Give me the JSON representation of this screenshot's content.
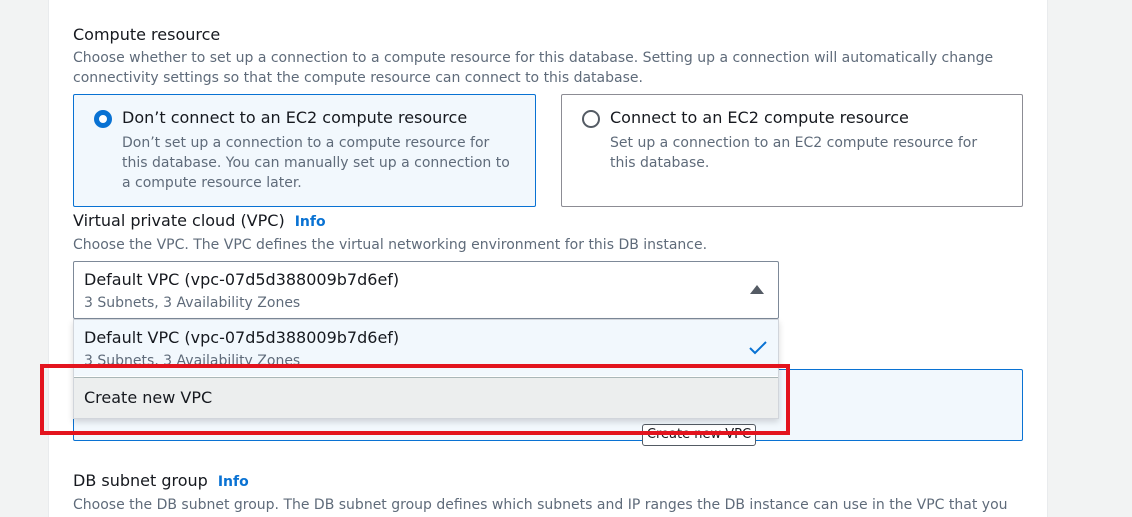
{
  "compute": {
    "title": "Compute resource",
    "description": "Choose whether to set up a connection to a compute resource for this database. Setting up a connection will automatically change connectivity settings so that the compute resource can connect to this database.",
    "options": [
      {
        "label": "Don’t connect to an EC2 compute resource",
        "description": "Don’t set up a connection to a compute resource for this database. You can manually set up a connection to a compute resource later.",
        "selected": true
      },
      {
        "label": "Connect to an EC2 compute resource",
        "description": "Set up a connection to an EC2 compute resource for this database.",
        "selected": false
      }
    ]
  },
  "vpc": {
    "title": "Virtual private cloud (VPC)",
    "info": "Info",
    "description": "Choose the VPC. The VPC defines the virtual networking environment for this DB instance.",
    "selected": {
      "label": "Default VPC (vpc-07d5d388009b7d6ef)",
      "sublabel": "3 Subnets, 3 Availability Zones"
    },
    "dropdown": {
      "options": [
        {
          "label": "Default VPC (vpc-07d5d388009b7d6ef)",
          "sublabel": "3 Subnets, 3 Availability Zones",
          "checked": true
        },
        {
          "label": "Create new VPC"
        }
      ]
    },
    "behind_button": "Create new VPC"
  },
  "subnet": {
    "title": "DB subnet group",
    "info": "Info",
    "description": "Choose the DB subnet group. The DB subnet group defines which subnets and IP ranges the DB instance can use in the VPC that you"
  },
  "colors": {
    "accent": "#0972d3",
    "highlight": "#e3141e"
  }
}
